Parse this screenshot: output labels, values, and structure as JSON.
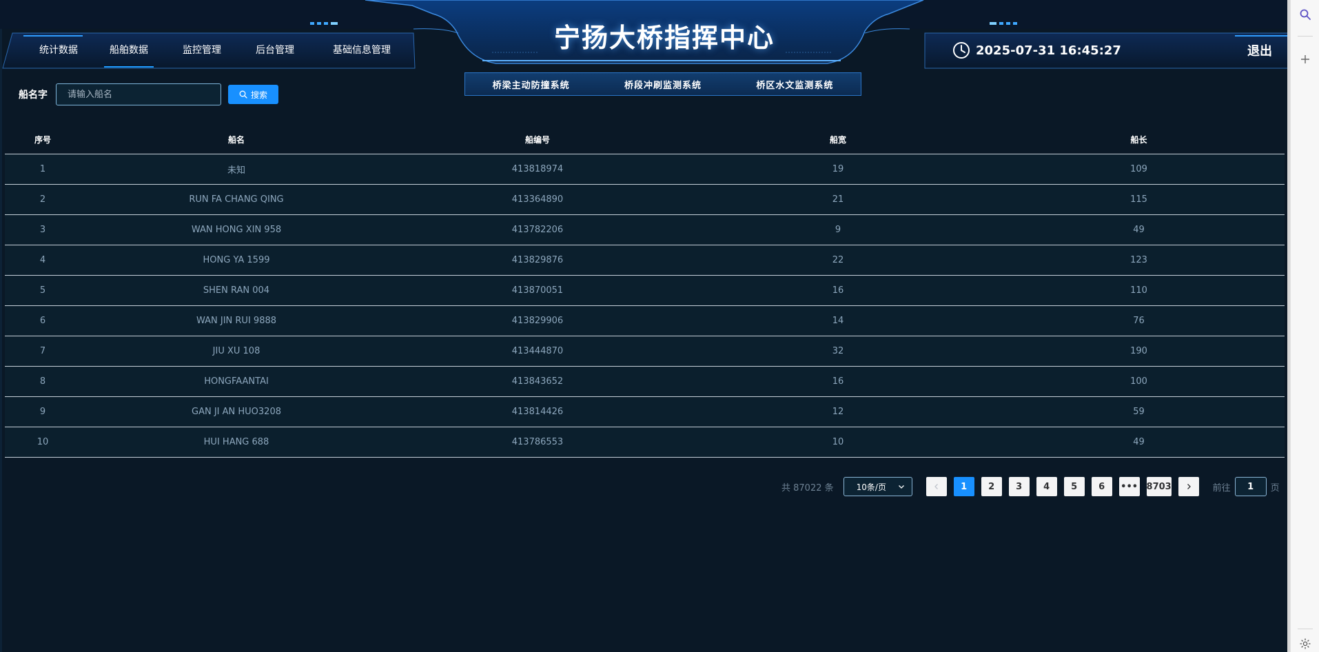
{
  "header": {
    "title": "宁扬大桥指挥中心",
    "datetime": "2025-07-31 16:45:27",
    "logout_label": "退出"
  },
  "nav": {
    "items": [
      {
        "label": "统计数据"
      },
      {
        "label": "船舶数据",
        "active": true
      },
      {
        "label": "监控管理"
      },
      {
        "label": "后台管理"
      },
      {
        "label": "基础信息管理"
      }
    ]
  },
  "subsystems": [
    {
      "label": "桥梁主动防撞系统"
    },
    {
      "label": "桥段冲刷监测系统"
    },
    {
      "label": "桥区水文监测系统"
    }
  ],
  "search": {
    "label": "船名字",
    "placeholder": "请输入船名",
    "button_label": "搜索"
  },
  "table": {
    "columns": [
      "序号",
      "船名",
      "船编号",
      "船宽",
      "船长"
    ],
    "rows": [
      [
        "1",
        "未知",
        "413818974",
        "19",
        "109"
      ],
      [
        "2",
        "RUN FA CHANG QING",
        "413364890",
        "21",
        "115"
      ],
      [
        "3",
        "WAN HONG XIN 958",
        "413782206",
        "9",
        "49"
      ],
      [
        "4",
        "HONG YA 1599",
        "413829876",
        "22",
        "123"
      ],
      [
        "5",
        "SHEN RAN 004",
        "413870051",
        "16",
        "110"
      ],
      [
        "6",
        "WAN JIN RUI 9888",
        "413829906",
        "14",
        "76"
      ],
      [
        "7",
        "JIU XU 108",
        "413444870",
        "32",
        "190"
      ],
      [
        "8",
        "HONGFAANTAI",
        "413843652",
        "16",
        "100"
      ],
      [
        "9",
        "GAN JI AN HUO3208",
        "413814426",
        "12",
        "59"
      ],
      [
        "10",
        "HUI HANG 688",
        "413786553",
        "10",
        "49"
      ]
    ]
  },
  "pagination": {
    "total_text": "共 87022 条",
    "page_size": "10条/页",
    "pages": [
      "1",
      "2",
      "3",
      "4",
      "5",
      "6",
      "•••",
      "8703"
    ],
    "current_page": "1",
    "goto_prefix": "前往",
    "goto_value": "1",
    "goto_suffix": "页"
  },
  "colors": {
    "accent": "#1890ff",
    "background": "#0a1826",
    "row_background": "#0b1f2d"
  },
  "sidebar_icons": [
    "search-icon",
    "plus-icon",
    "gear-icon"
  ]
}
